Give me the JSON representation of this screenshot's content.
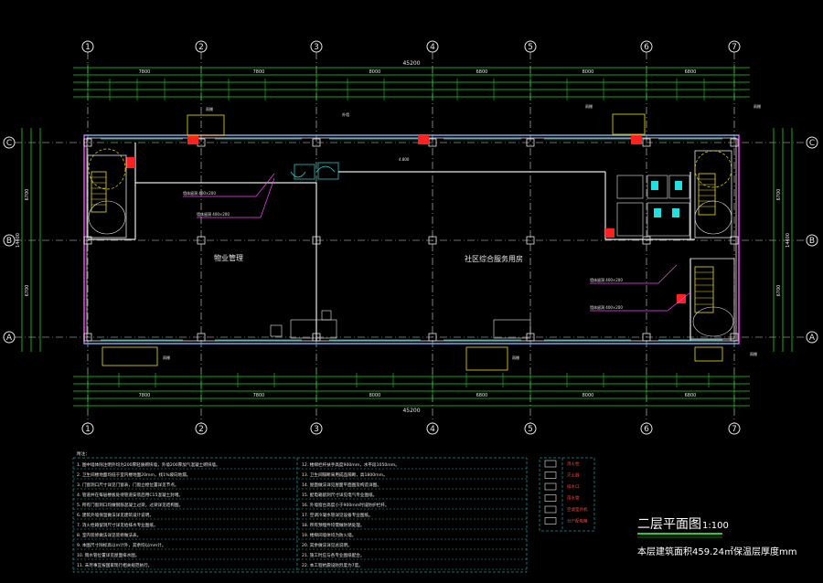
{
  "title": {
    "text": "二层平面图",
    "scale": "1:100",
    "area_note": "本层建筑面积459.24㎡保温层厚度mm"
  },
  "grid": {
    "columns": [
      "1",
      "2",
      "3",
      "4",
      "5",
      "6",
      "7"
    ],
    "rows": [
      "C",
      "B",
      "A"
    ],
    "total_width": "45200",
    "bay_dims": [
      "7800",
      "7800",
      "8000",
      "6800",
      "8000",
      "6800"
    ],
    "bottom_bay_dims": [
      "7800",
      "7800",
      "8000",
      "6800",
      "8000",
      "6800"
    ],
    "row_dims_left": [
      "6700",
      "6700"
    ],
    "row_total_left": "14400",
    "row_dims_right": [
      "6700",
      "6700"
    ],
    "row_total_right": "14400"
  },
  "rooms": [
    {
      "name": "物业管理"
    },
    {
      "name": "社区综合服务用房"
    }
  ],
  "tags": {
    "yupeng": "雨棚",
    "level": "4.800",
    "wall_note": "外墙"
  },
  "notes_header": "附注：",
  "notes_left": [
    "1. 图中墙体除注明外均为200厚轻质砌块墙，外墙200厚加气混凝土砌块墙。",
    "2. 卫生间楼地面均低于室内楼地面20mm，找1%坡向地漏。",
    "3. 门窗洞口尺寸详见门窗表，门窗立樘位置详见节点。",
    "4. 管道井在每层楼板处待管道安装后用C15混凝土封堵。",
    "5. 所有门窗洞口均做钢筋混凝土过梁，过梁详见结构图。",
    "6. 建筑外墙保温做法详见建筑设计说明。",
    "7. 消火栓箱留洞尺寸详见给排水专业图纸。",
    "8. 室内装修做法详见装修做法表。",
    "9. 本图尺寸除标高以m计外，其余均以mm计。",
    "10. 雨水管位置详见屋面排水图。",
    "11. 未尽事宜按国家现行相关规范执行。"
  ],
  "notes_right": [
    "12. 楼梯栏杆扶手高度900mm，水平段1050mm。",
    "13. 卫生间隔断采用成品隔断，高1800mm。",
    "14. 屋面做法详见屋面平面图及构造详图。",
    "15. 配电箱留洞尺寸详见电气专业图纸。",
    "16. 外墙窗台高度小于900mm时设防护栏杆。",
    "17. 空调冷凝水管详见设备专业图纸。",
    "18. 所有预埋件均需做防锈处理。",
    "19. 楼梯间墙体均为防火墙。",
    "20. 其余做法详见总说明。",
    "21. 施工时应与各专业图纸配合。",
    "22. 本工程抗震设防烈度为7度。"
  ],
  "legend": [
    {
      "symbol": "stair-icon",
      "label": "消火栓"
    },
    {
      "symbol": "hazard-icon",
      "label": "灭火器"
    },
    {
      "symbol": "ring-icon",
      "label": "排水口"
    },
    {
      "symbol": "arrow-icon",
      "label": "雨水管"
    },
    {
      "symbol": "arrow-icon",
      "label": "空调室外机"
    },
    {
      "symbol": "box-icon",
      "label": "分户配电箱"
    }
  ],
  "colors": {
    "background": "#000000",
    "lines": "#e8e8e8",
    "dims": "#19d619",
    "windows": "#22e0e0",
    "columns": "#ff40ff",
    "hydrant": "#ff2020",
    "yellow": "#f0e000"
  }
}
